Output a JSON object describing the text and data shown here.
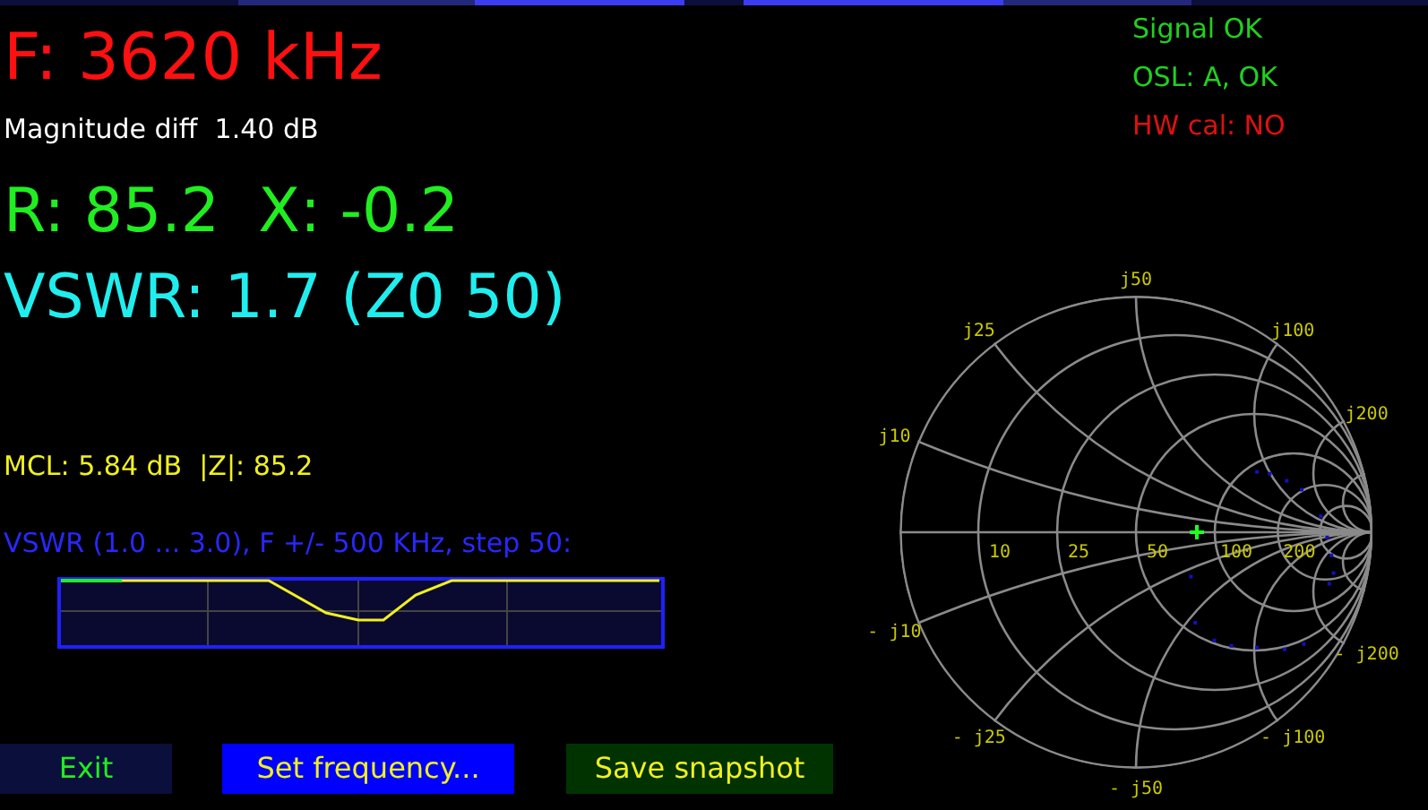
{
  "top_bar": [
    {
      "color": "#0c0f3c"
    },
    {
      "color": "#24287c"
    },
    {
      "color": "#3c3cf0"
    },
    {
      "color": "#0c0f3c"
    },
    {
      "color": "#3c3cf0"
    },
    {
      "color": "#24287c"
    },
    {
      "color": "#0c0f3c"
    }
  ],
  "frequency": "F: 3620 kHz",
  "magnitude_diff": "Magnitude diff  1.40 dB",
  "impedance": "R: 85.2  X: -0.2",
  "vswr": "VSWR: 1.7 (Z0 50)",
  "status": [
    {
      "text": "Signal OK",
      "ok": true
    },
    {
      "text": "OSL: A, OK",
      "ok": true
    },
    {
      "text": "HW cal: NO",
      "ok": false
    }
  ],
  "mcl": "MCL: 5.84 dB  |Z|: 85.2",
  "sweep_caption": "VSWR (1.0 ... 3.0), F +/- 500 KHz, step 50:",
  "smith_chart": {
    "resistance_labels": [
      "10",
      "25",
      "50",
      "100",
      "200"
    ],
    "reactance_labels": [
      "j10",
      "j25",
      "j50",
      "j100",
      "j200",
      "- j10",
      "- j25",
      "- j50",
      "- j100",
      "- j200"
    ]
  },
  "buttons": [
    {
      "label": "Exit",
      "kind": "exit"
    },
    {
      "label": "Set frequency...",
      "kind": "primary"
    },
    {
      "label": "Save snapshot",
      "kind": "save"
    }
  ]
}
